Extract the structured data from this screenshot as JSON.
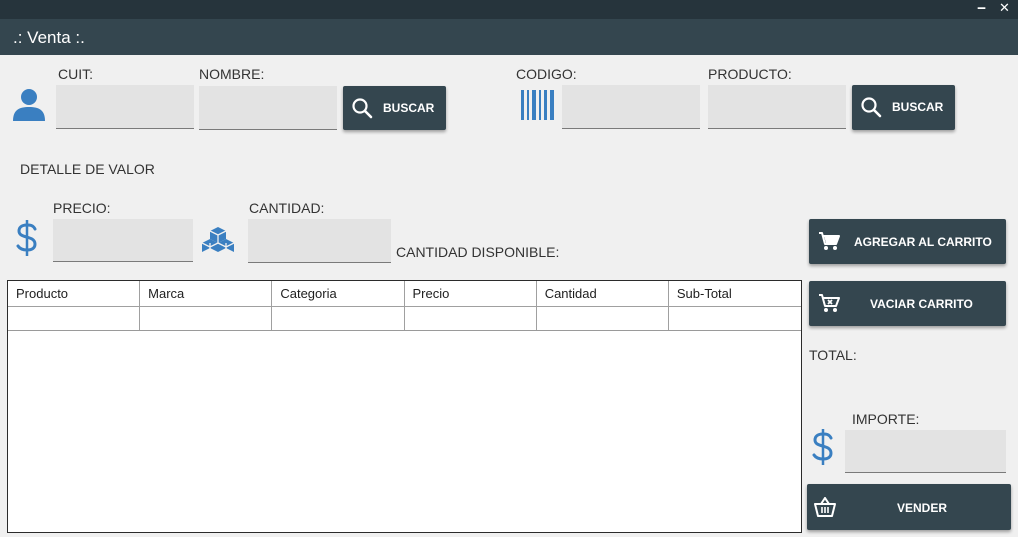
{
  "window": {
    "minimize_glyph": "‒",
    "close_glyph": "✕",
    "title": ".: Venta :."
  },
  "cliente": {
    "cuit_label": "CUIT:",
    "nombre_label": "NOMBRE:",
    "cuit_value": "",
    "nombre_value": "",
    "buscar_label": "BUSCAR",
    "icon": "user-icon"
  },
  "producto": {
    "codigo_label": "CODIGO:",
    "producto_label": "PRODUCTO:",
    "codigo_value": "",
    "producto_value": "",
    "buscar_label": "BUSCAR",
    "icon": "barcode-icon"
  },
  "detalle": {
    "section_label": "DETALLE DE VALOR",
    "precio_label": "PRECIO:",
    "cantidad_label": "CANTIDAD:",
    "precio_value": "",
    "cantidad_value": "",
    "cantidad_disponible_label": "CANTIDAD DISPONIBLE:"
  },
  "actions": {
    "agregar_label": "AGREGAR AL CARRITO",
    "vaciar_label": "VACIAR CARRITO",
    "vender_label": "VENDER"
  },
  "totals": {
    "total_label": "TOTAL:",
    "importe_label": "IMPORTE:",
    "importe_value": ""
  },
  "table": {
    "columns": [
      "Producto",
      "Marca",
      "Categoria",
      "Precio",
      "Cantidad",
      "Sub-Total"
    ],
    "rows": [
      [
        "",
        "",
        "",
        "",
        "",
        ""
      ]
    ]
  },
  "colors": {
    "titlebar": "#26343c",
    "header": "#34464f",
    "button": "#34464f",
    "icon_blue": "#3a7fc1",
    "background": "#f0f0f0"
  }
}
